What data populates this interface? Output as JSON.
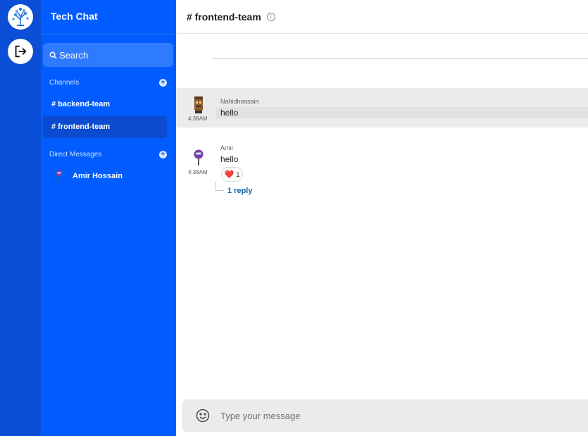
{
  "app": {
    "name": "Tech Chat"
  },
  "search": {
    "placeholder": "Search"
  },
  "sections": {
    "channels": {
      "title": "Channels"
    },
    "direct_messages": {
      "title": "Direct Messages"
    }
  },
  "channels": [
    {
      "label": "# backend-team",
      "active": false
    },
    {
      "label": "# frontend-team",
      "active": true
    }
  ],
  "direct_messages": [
    {
      "name": "Amir Hossain"
    }
  ],
  "header": {
    "channel": "# frontend-team",
    "icon": "info-icon"
  },
  "messages": [
    {
      "author": "Nahidhossain",
      "time": "4:38AM",
      "text": "hello",
      "highlighted": true
    },
    {
      "author": "Amir",
      "time": "4:38AM",
      "text": "hello",
      "reaction": {
        "emoji": "❤️",
        "count": "1"
      },
      "replies": "1 reply"
    }
  ],
  "composer": {
    "placeholder": "Type your message",
    "icon": "emoji-icon"
  },
  "colors": {
    "rail": "#0a4fd6",
    "sidebar": "#005cff",
    "active_channel": "#0a4bd0",
    "reply_link": "#1264a3"
  }
}
